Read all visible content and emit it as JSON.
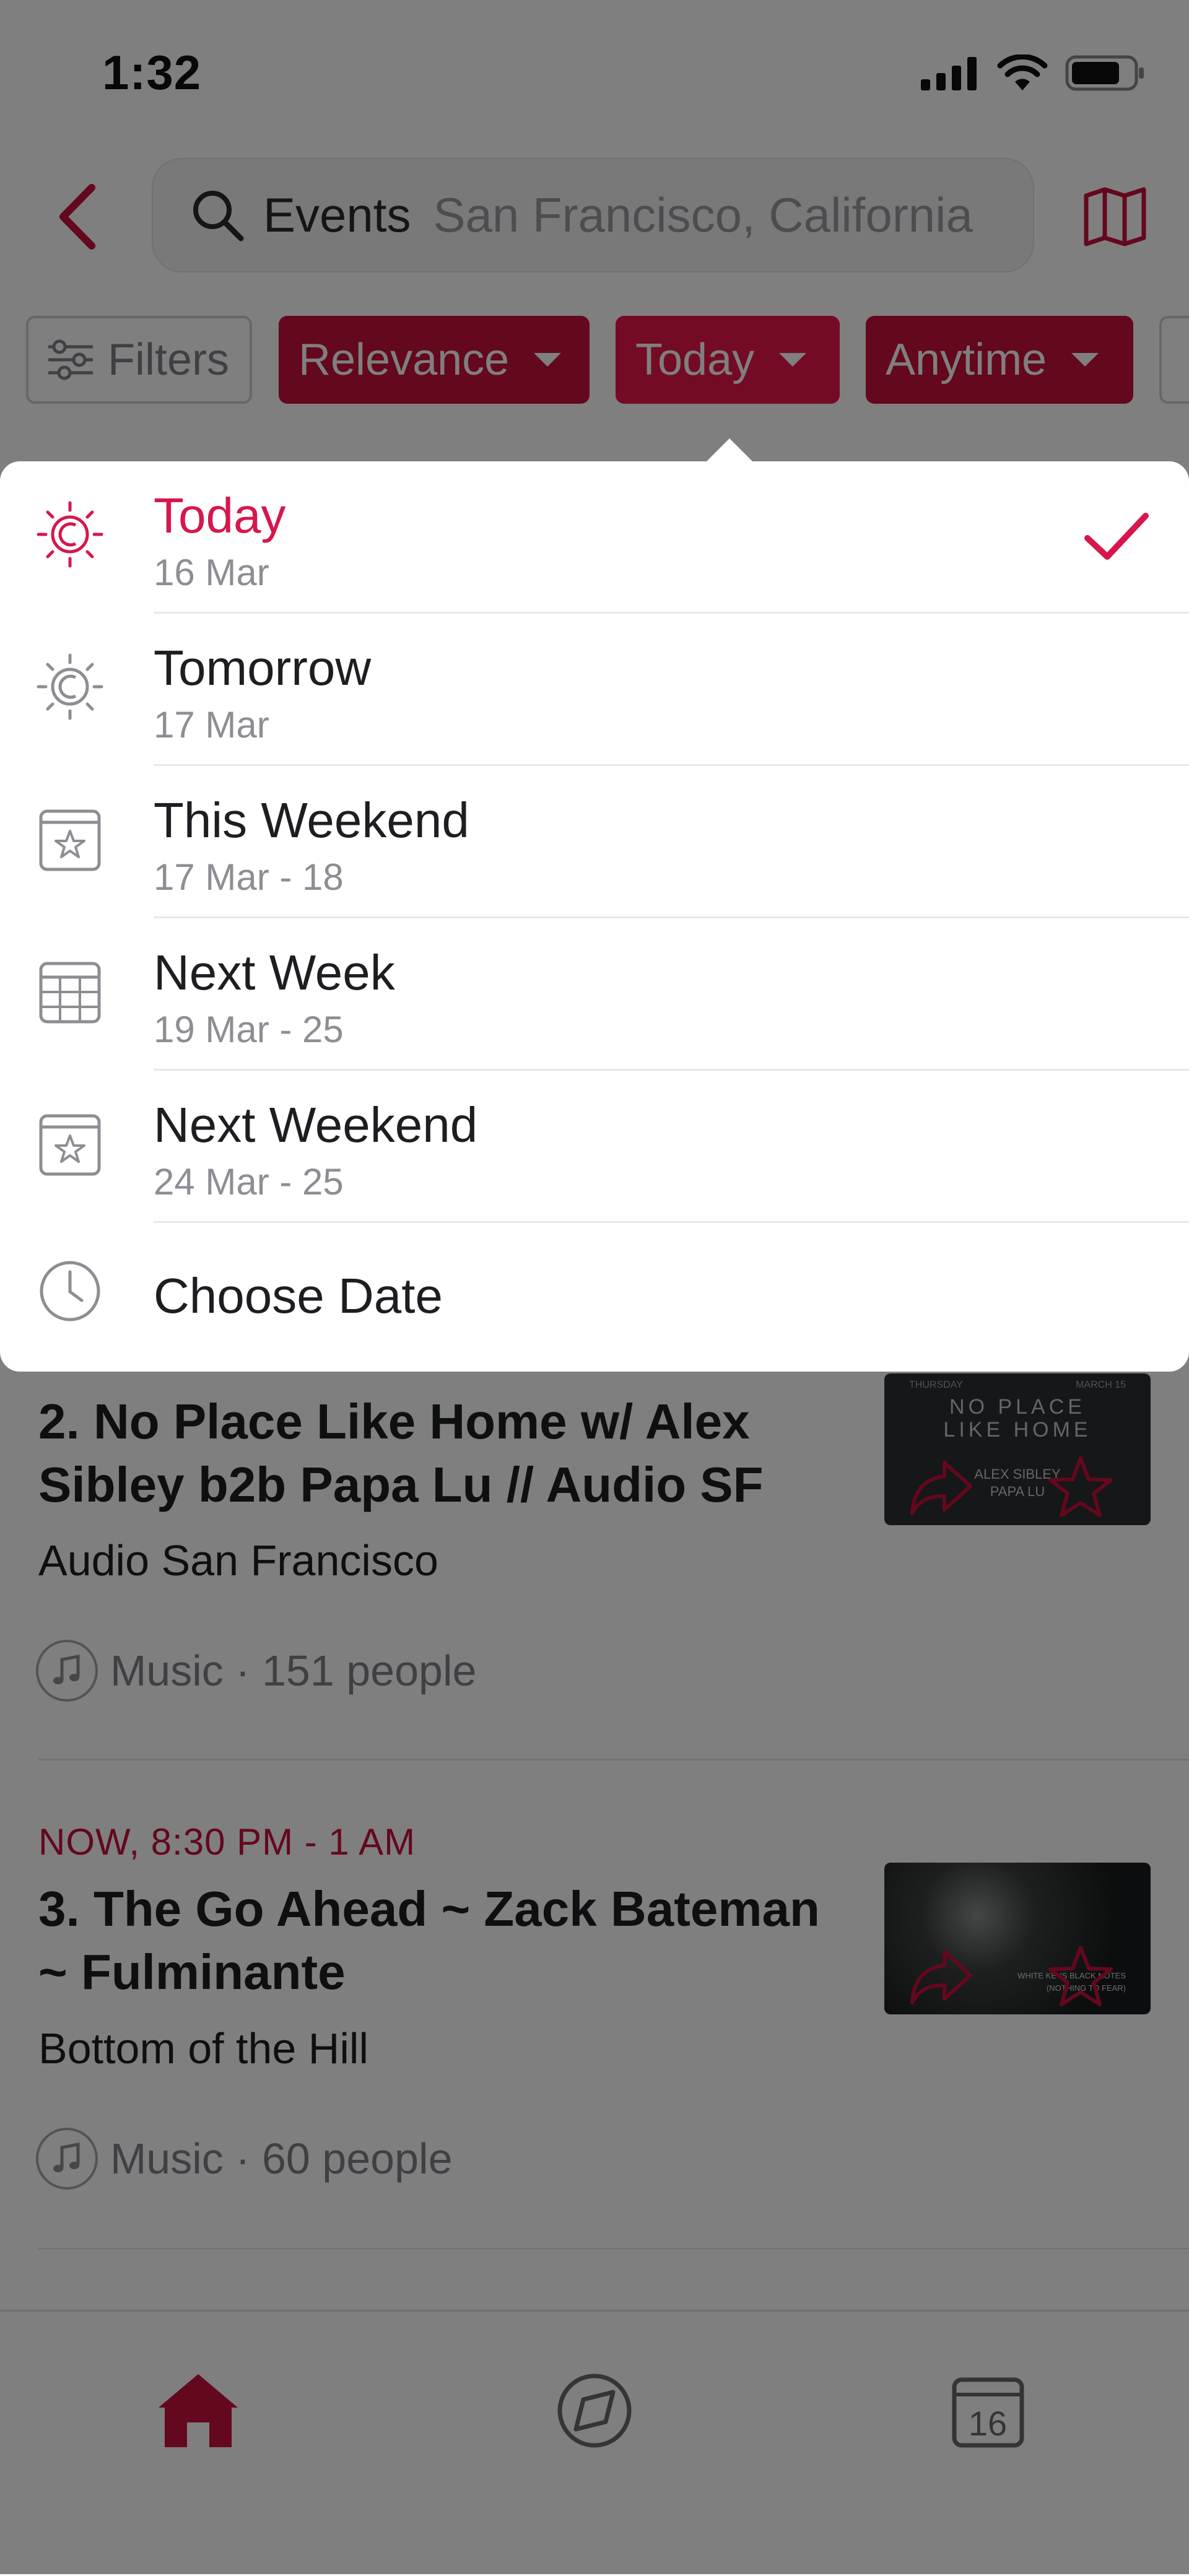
{
  "status_bar": {
    "time": "1:32"
  },
  "header": {
    "search_label": "Events",
    "search_location": "San Francisco, California"
  },
  "filters": {
    "filters_label": "Filters",
    "relevance_label": "Relevance",
    "today_label": "Today",
    "anytime_label": "Anytime"
  },
  "dropdown": {
    "options": [
      {
        "title": "Today",
        "subtitle": "16 Mar",
        "icon": "sun-icon",
        "selected": true
      },
      {
        "title": "Tomorrow",
        "subtitle": "17 Mar",
        "icon": "sun-outline-icon",
        "selected": false
      },
      {
        "title": "This Weekend",
        "subtitle": "17 Mar - 18",
        "icon": "calendar-star-icon",
        "selected": false
      },
      {
        "title": "Next Week",
        "subtitle": "19 Mar - 25",
        "icon": "calendar-grid-icon",
        "selected": false
      },
      {
        "title": "Next Weekend",
        "subtitle": "24 Mar - 25",
        "icon": "calendar-star-icon",
        "selected": false
      },
      {
        "title": "Choose Date",
        "subtitle": "",
        "icon": "clock-icon",
        "selected": false
      }
    ]
  },
  "events": [
    {
      "title": "2. No Place Like Home w/ Alex Sibley b2b Papa Lu // Audio SF",
      "venue": "Audio San Francisco",
      "category": "Music",
      "people": "151 people",
      "meta": "Music · 151 people",
      "thumb_lines": [
        "THURSDAY",
        "MARCH 15",
        "NO PLACE",
        "LIKE HOME",
        "ALEX SIBLEY",
        "PAPA LU"
      ]
    },
    {
      "time": "NOW, 8:30 PM - 1 AM",
      "title": "3. The Go Ahead ~ Zack Bateman ~ Fulminante",
      "venue": "Bottom of the Hill",
      "category": "Music",
      "people": "60 people",
      "meta": "Music · 60 people",
      "thumb_lines": [
        "WHITE KEYS BLACK NOTES",
        "(NOTHING TO FEAR)"
      ]
    }
  ],
  "tab_bar": {
    "calendar_day": "16"
  },
  "colors": {
    "accent": "#d6174c",
    "chip_dark": "#c8103b",
    "chip_active": "#e8174a"
  }
}
